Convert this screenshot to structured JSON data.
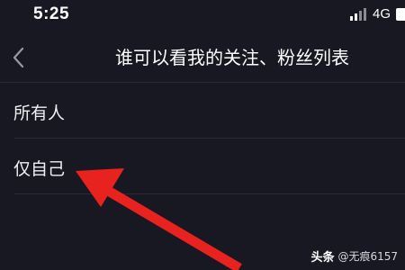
{
  "status_bar": {
    "time": "5:25",
    "network": "4G",
    "signal_icon": "signal-bars-icon",
    "battery_icon": "battery-icon"
  },
  "nav": {
    "back_icon": "chevron-left-icon",
    "title": "谁可以看我的关注、粉丝列表"
  },
  "options": [
    {
      "label": "所有人"
    },
    {
      "label": "仅自己"
    }
  ],
  "annotation": {
    "arrow_color": "#e8231f"
  },
  "watermark": {
    "logo": "头条",
    "handle": "@无痕6157"
  },
  "colors": {
    "background": "#181823",
    "divider": "#2a2a35",
    "text": "#f2f2f4"
  }
}
